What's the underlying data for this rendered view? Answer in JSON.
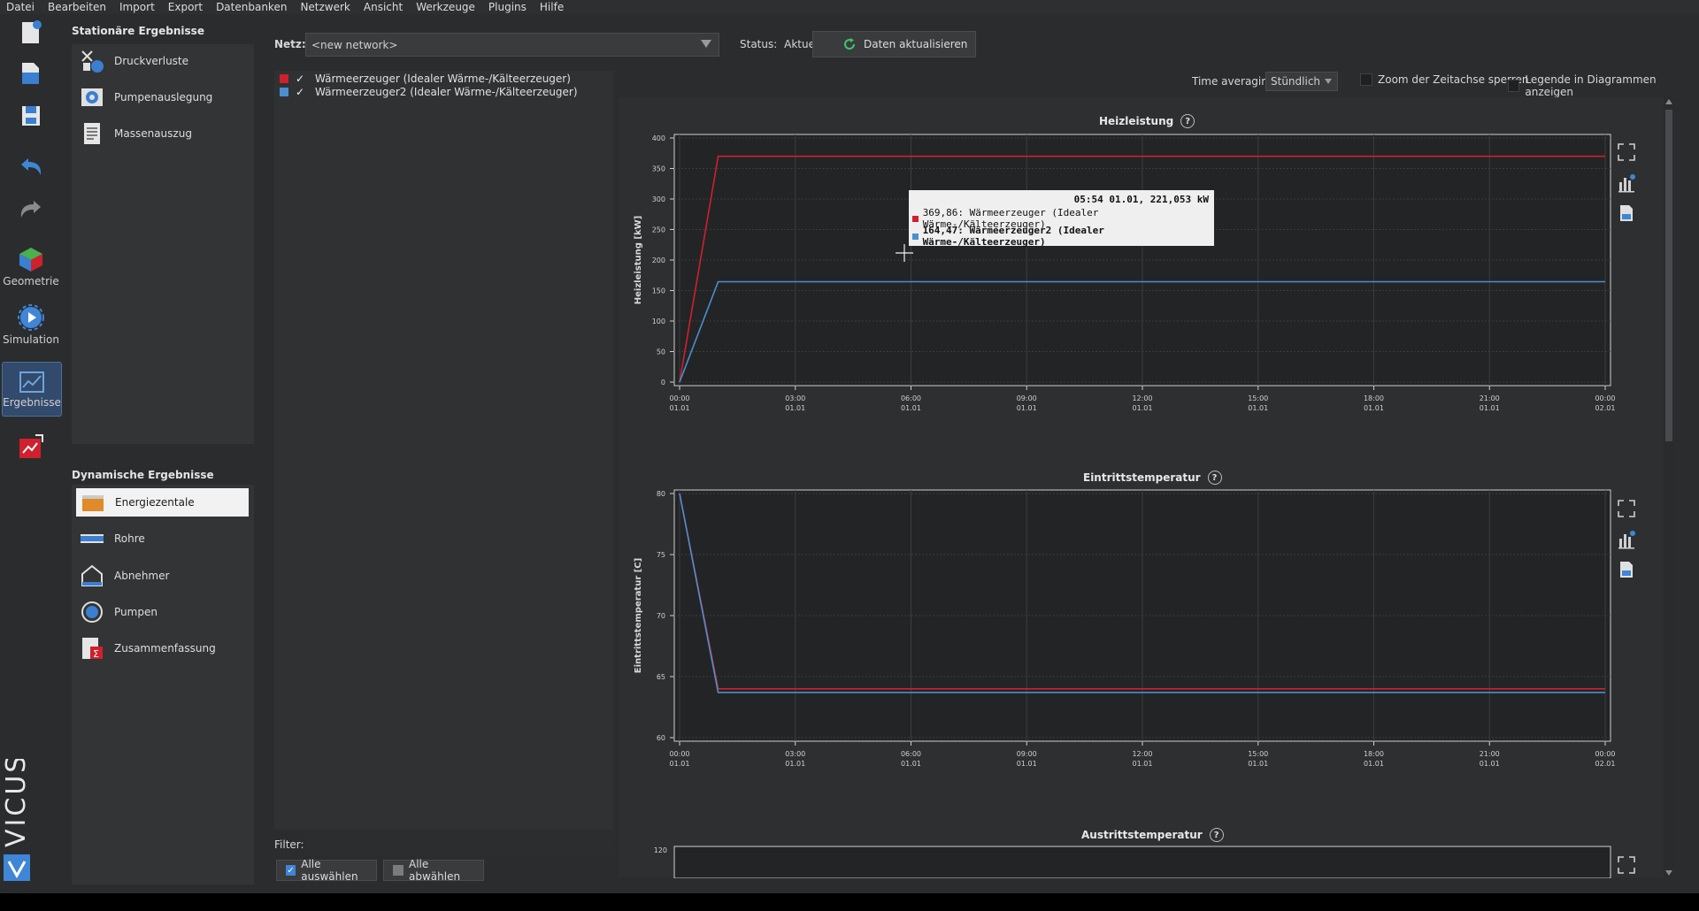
{
  "menu": [
    "Datei",
    "Bearbeiten",
    "Import",
    "Export",
    "Datenbanken",
    "Netzwerk",
    "Ansicht",
    "Werkzeuge",
    "Plugins",
    "Hilfe"
  ],
  "rail": {
    "geometry_label": "Geometrie",
    "simulation_label": "Simulation",
    "results_label": "Ergebnisse",
    "logo_text": "VICUS"
  },
  "stationary": {
    "title": "Stationäre Ergebnisse",
    "items": [
      "Druckverluste",
      "Pumpenauslegung",
      "Massenauszug"
    ]
  },
  "dynamic": {
    "title": "Dynamische Ergebnisse",
    "items": [
      "Energiezentale",
      "Rohre",
      "Abnehmer",
      "Pumpen",
      "Zusammenfassung"
    ],
    "selected": "Energiezentale"
  },
  "topbar": {
    "network_label": "Netz:",
    "network_value": "<new network>",
    "status_label": "Status:",
    "status_value": "Aktuell",
    "refresh_label": "Daten aktualisieren"
  },
  "series_list": [
    {
      "name": "Wärmeerzeuger (Idealer Wärme-/Kälteerzeuger)",
      "color": "#d0202e",
      "checked": true
    },
    {
      "name": "Wärmeerzeuger2 (Idealer Wärme-/Kälteerzeuger)",
      "color": "#4a8fd0",
      "checked": true
    }
  ],
  "filter_label": "Filter:",
  "select_all": "Alle auswählen",
  "deselect_all": "Alle abwählen",
  "options": {
    "time_averaging_label": "Time averaging",
    "time_averaging_value": "Stündlich",
    "lock_zoom_label": "Zoom der Zeitachse sperren",
    "show_legend_label": "Legende in Diagrammen anzeigen"
  },
  "tooltip": {
    "header": "05:54 01.01, 221,053 kW",
    "line1": "369,86: Wärmeerzeuger (Idealer Wärme-/Kälteerzeuger)",
    "line2": "164,47: Wärmeerzeuger2 (Idealer Wärme-/Kälteerzeuger)"
  },
  "x_ticks": [
    {
      "t": "00:00",
      "d": "01.01"
    },
    {
      "t": "03:00",
      "d": "01.01"
    },
    {
      "t": "06:00",
      "d": "01.01"
    },
    {
      "t": "09:00",
      "d": "01.01"
    },
    {
      "t": "12:00",
      "d": "01.01"
    },
    {
      "t": "15:00",
      "d": "01.01"
    },
    {
      "t": "18:00",
      "d": "01.01"
    },
    {
      "t": "21:00",
      "d": "01.01"
    },
    {
      "t": "00:00",
      "d": "02.01"
    }
  ],
  "chart_data": [
    {
      "type": "line",
      "title": "Heizleistung",
      "ylabel": "Heizleistung [kW]",
      "xlim": [
        0,
        24
      ],
      "ylim": [
        0,
        400
      ],
      "yticks": [
        0,
        50,
        100,
        150,
        200,
        250,
        300,
        350,
        400
      ],
      "series": [
        {
          "color": "#d0202e",
          "x": [
            0,
            1,
            24
          ],
          "y": [
            0,
            370,
            370
          ]
        },
        {
          "color": "#4a8fd0",
          "x": [
            0,
            1,
            24
          ],
          "y": [
            0,
            164.5,
            164.5
          ]
        }
      ]
    },
    {
      "type": "line",
      "title": "Eintrittstemperatur",
      "ylabel": "Eintrittstemperatur [C]",
      "xlim": [
        0,
        24
      ],
      "ylim": [
        60,
        80
      ],
      "yticks": [
        60,
        65,
        70,
        75,
        80
      ],
      "series": [
        {
          "color": "#d0202e",
          "x": [
            0,
            1,
            24
          ],
          "y": [
            80,
            64.0,
            64.0
          ]
        },
        {
          "color": "#4a8fd0",
          "x": [
            0,
            1,
            24
          ],
          "y": [
            80,
            63.7,
            63.7
          ]
        }
      ]
    },
    {
      "type": "line",
      "title": "Austrittstemperatur",
      "ylabel": "",
      "yticks": [
        120
      ]
    }
  ]
}
